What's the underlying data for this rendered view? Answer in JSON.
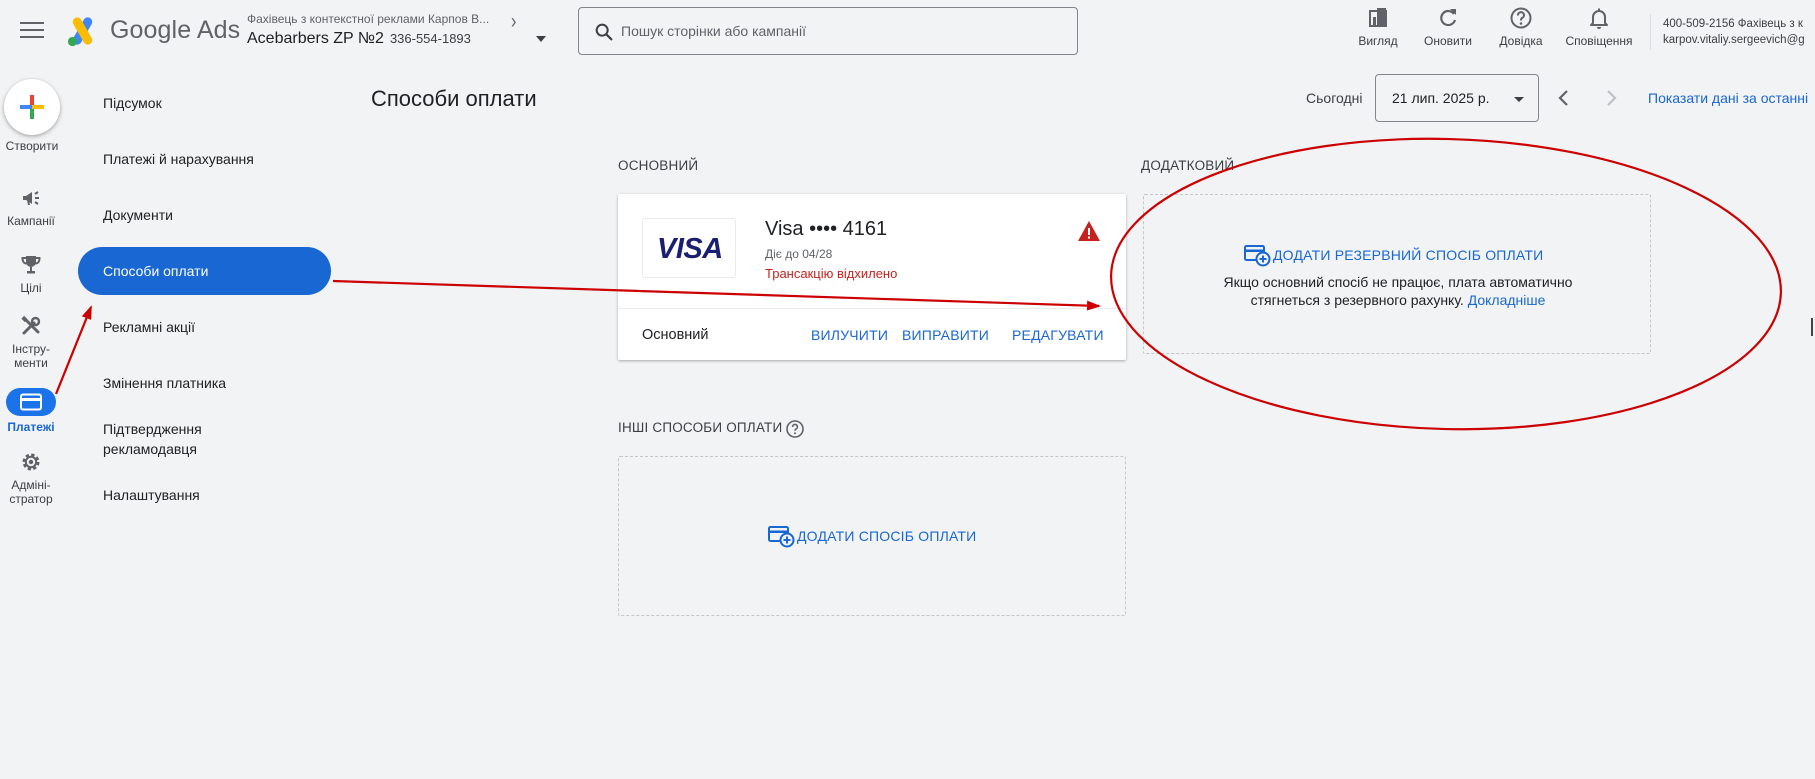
{
  "header": {
    "app_name": "Google Ads",
    "account_subtitle": "Фахівець з контекстної реклами Карпов В...",
    "account_name": "Acebarbers ZP №2",
    "account_id": "336-554-1893",
    "search_placeholder": "Пошук сторінки або кампанії",
    "tools": [
      {
        "label": "Вигляд",
        "icon": "appearance-icon"
      },
      {
        "label": "Оновити",
        "icon": "refresh-icon"
      },
      {
        "label": "Довідка",
        "icon": "help-icon"
      },
      {
        "label": "Сповіщення",
        "icon": "bell-icon"
      }
    ],
    "user_line1": "400-509-2156 Фахівець з к",
    "user_line2": "karpov.vitaliy.sergeevich@g"
  },
  "rail": {
    "create_label": "Створити",
    "items": [
      {
        "label": "Кампанії",
        "icon": "megaphone-icon"
      },
      {
        "label": "Цілі",
        "icon": "trophy-icon"
      },
      {
        "label": "Інстру-\nменти",
        "icon": "tools-icon"
      },
      {
        "label": "Платежі",
        "icon": "credit-card-icon",
        "active": true
      },
      {
        "label": "Адміні-\nстратор",
        "icon": "gear-icon"
      }
    ]
  },
  "sidenav": {
    "items": [
      {
        "label": "Підсумок"
      },
      {
        "label": "Платежі й нарахування"
      },
      {
        "label": "Документи"
      },
      {
        "label": "Способи оплати",
        "active": true
      },
      {
        "label": "Рекламні акції"
      },
      {
        "label": "Змінення платника"
      },
      {
        "label": "Підтвердження рекламодавця"
      },
      {
        "label": "Налаштування"
      }
    ]
  },
  "page": {
    "title": "Способи оплати",
    "today_label": "Сьогодні",
    "date_value": "21 лип. 2025 р.",
    "show_data_link": "Показати дані за останні"
  },
  "primary": {
    "section_label": "ОСНОВНИЙ",
    "card": {
      "brand": "VISA",
      "name": "Visa •••• 4161",
      "expiry": "Діє до 04/28",
      "error": "Трансакцію відхилено",
      "status_label": "Основний",
      "remove_button": "ВИЛУЧИТИ",
      "fix_button": "ВИПРАВИТИ",
      "edit_button": "РЕДАГУВАТИ"
    }
  },
  "backup": {
    "section_label": "ДОДАТКОВИЙ",
    "add_link": "ДОДАТИ РЕЗЕРВНИЙ СПОСІБ ОПЛАТИ",
    "description_line1": "Якщо основний спосіб не працює, плата автоматично",
    "description_line2": "стягнеться з резервного рахунку.",
    "learn_more": "Докладніше"
  },
  "others": {
    "section_label": "ІНШІ СПОСОБИ ОПЛАТИ",
    "add_link": "ДОДАТИ СПОСІБ ОПЛАТИ"
  },
  "colors": {
    "accent": "#1967d2",
    "error": "#c5221f",
    "annotation": "#cc0000",
    "background": "#f1f3f4"
  }
}
